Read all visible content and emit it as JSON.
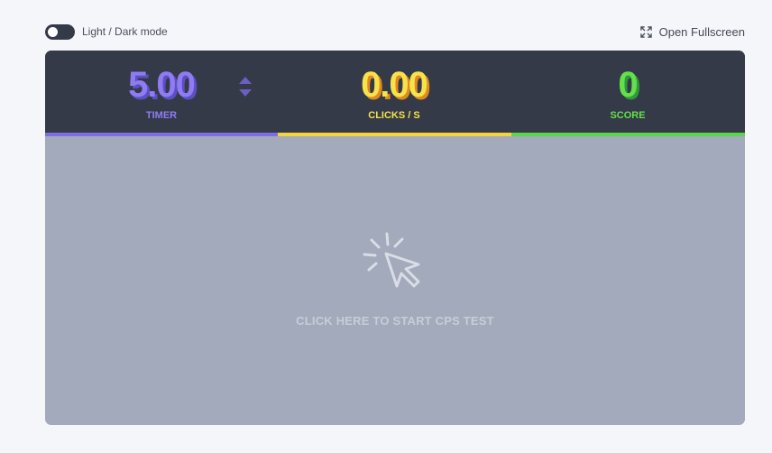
{
  "toolbar": {
    "mode_toggle_label": "Light / Dark mode",
    "fullscreen_label": "Open Fullscreen",
    "toggle_state": "off"
  },
  "stats": {
    "timer": {
      "value": "5.00",
      "label": "TIMER"
    },
    "clicks": {
      "value": "0.00",
      "label": "CLICKS / S"
    },
    "score": {
      "value": "0",
      "label": "SCORE"
    }
  },
  "click_area": {
    "prompt": "CLICK HERE TO START CPS TEST"
  },
  "icons": {
    "fullscreen": "expand-arrows-icon",
    "spinner": "up-down-arrows-icon",
    "click": "cursor-click-icon"
  },
  "colors": {
    "timer": "#8f7cf5",
    "clicks": "#f6e24a",
    "score": "#63e04a",
    "header_bg": "#343a47",
    "click_area_bg": "#a2aabb"
  }
}
